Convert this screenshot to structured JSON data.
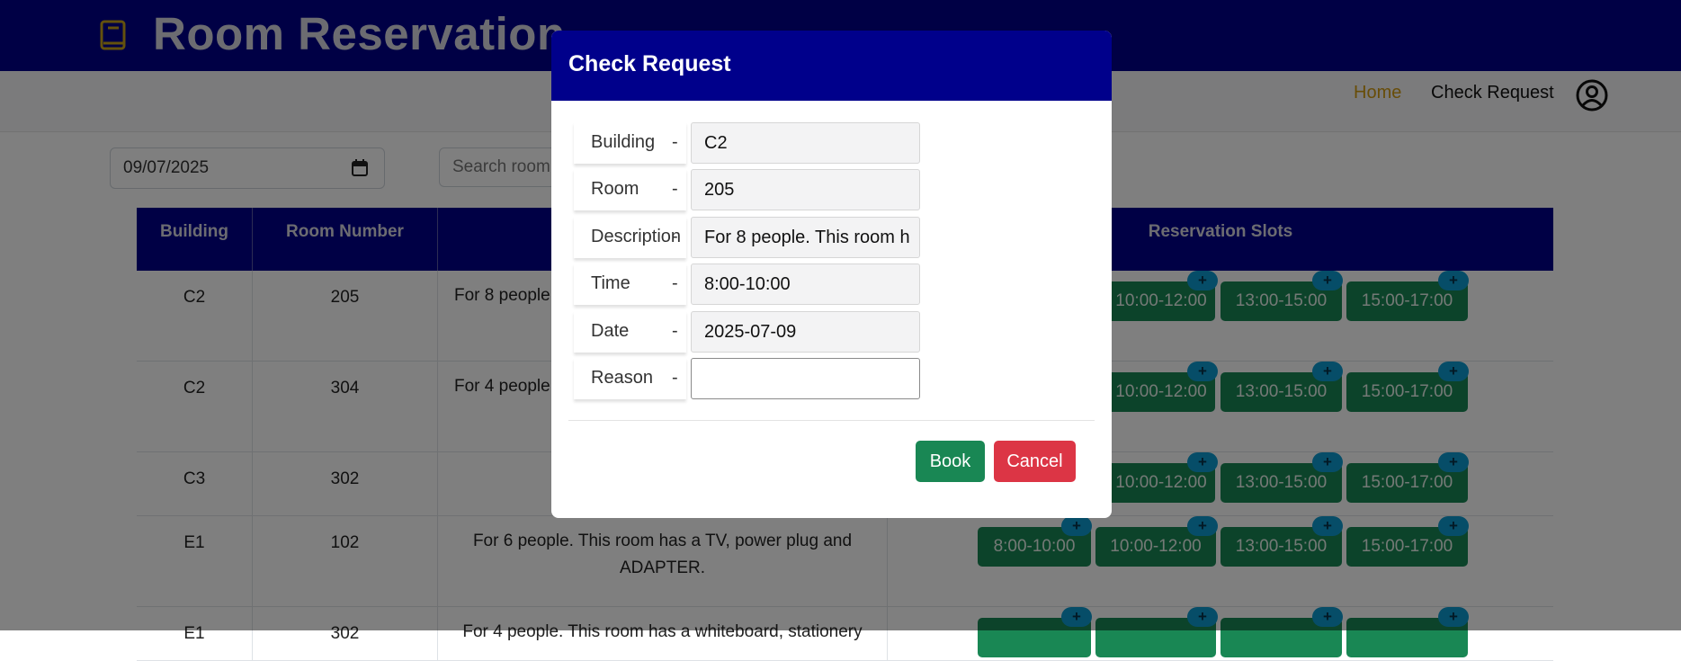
{
  "header": {
    "title": "Room Reservation"
  },
  "nav": {
    "home": "Home",
    "check_request": "Check Request"
  },
  "filters": {
    "date": "09/07/2025",
    "search_placeholder": "Search room"
  },
  "table": {
    "headers": [
      "Building",
      "Room Number",
      "Reservation Slots"
    ],
    "rows": [
      {
        "building": "C2",
        "room": "205",
        "description": "For 8 people",
        "slots": [
          "10:00-12:00",
          "13:00-15:00",
          "15:00-17:00"
        ]
      },
      {
        "building": "C2",
        "room": "304",
        "description": "For 4 people",
        "slots": [
          "10:00-12:00",
          "13:00-15:00",
          "15:00-17:00"
        ]
      },
      {
        "building": "C3",
        "room": "302",
        "description": "",
        "slots": [
          "10:00-12:00",
          "13:00-15:00",
          "15:00-17:00"
        ]
      },
      {
        "building": "E1",
        "room": "102",
        "description": "For 6 people. This room has a TV, power plug and ADAPTER.",
        "slots": [
          "8:00-10:00",
          "10:00-12:00",
          "13:00-15:00",
          "15:00-17:00"
        ]
      },
      {
        "building": "E1",
        "room": "302",
        "description": "For 4 people. This room has a whiteboard, stationery",
        "slots": []
      }
    ],
    "plus": "+"
  },
  "modal": {
    "title": "Check Request",
    "separator": "-",
    "fields": [
      {
        "label": "Building",
        "value": "C2"
      },
      {
        "label": "Room",
        "value": "205"
      },
      {
        "label": "Description",
        "value": "For 8 people. This room h"
      },
      {
        "label": "Time",
        "value": "8:00-10:00"
      },
      {
        "label": "Date",
        "value": "2025-07-09"
      },
      {
        "label": "Reason",
        "value": ""
      }
    ],
    "book": "Book",
    "cancel": "Cancel"
  },
  "colors": {
    "primary": "#00008b",
    "slot": "#198754",
    "plus_badge": "#0d9bd1",
    "book": "#198754",
    "cancel": "#dc3545",
    "home_link": "#d09a10"
  }
}
